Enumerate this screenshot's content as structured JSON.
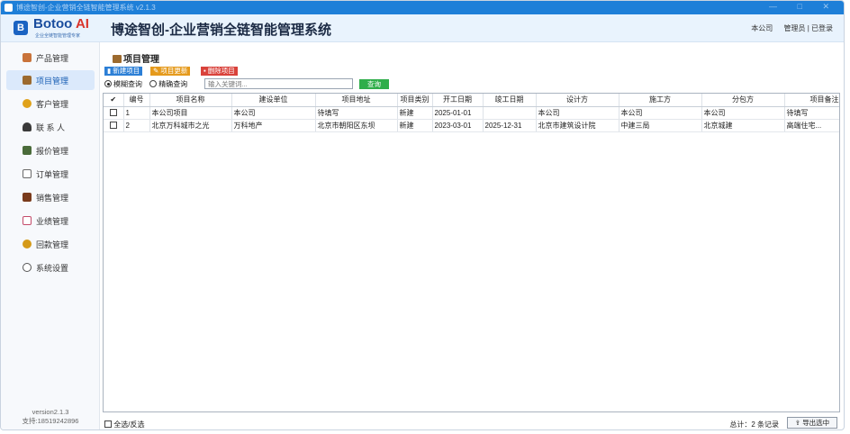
{
  "window": {
    "title": "博途智创-企业营销全链智能管理系统 v2.1.3",
    "controls": "— □ ✕"
  },
  "header": {
    "logo_letter": "B",
    "logo_text": "Botoo",
    "logo_ai": "AI",
    "logo_sub": "企业全链智能管理专家",
    "app_title": "博途智创-企业营销全链智能管理系统",
    "company": "本公司",
    "user": "管理员 | 已登录"
  },
  "sidebar": {
    "items": [
      {
        "label": "产品管理",
        "icon": "product-icon",
        "color": "#c9733a"
      },
      {
        "label": "项目管理",
        "icon": "project-icon",
        "color": "#9c6a2e"
      },
      {
        "label": "客户管理",
        "icon": "customer-icon",
        "color": "#e0a21a"
      },
      {
        "label": "联 系 人",
        "icon": "contacts-icon",
        "color": "#3a3a3a"
      },
      {
        "label": "报价管理",
        "icon": "quote-icon",
        "color": "#4a6b3a"
      },
      {
        "label": "订单管理",
        "icon": "order-icon",
        "color": "#6a6a6a"
      },
      {
        "label": "销售管理",
        "icon": "sales-icon",
        "color": "#7a3b1c"
      },
      {
        "label": "业绩管理",
        "icon": "performance-icon",
        "color": "#c44b6a"
      },
      {
        "label": "回款管理",
        "icon": "payment-icon",
        "color": "#d59a18"
      },
      {
        "label": "系统设置",
        "icon": "settings-icon",
        "color": "#555555"
      }
    ],
    "active_index": 1,
    "version": "version2.1.3",
    "support": "支持:18519242896"
  },
  "main": {
    "page_title": "项目管理",
    "toolbar": {
      "new_label": "新建项目",
      "edit_label": "项目更新",
      "delete_label": "删除项目"
    },
    "search": {
      "fuzzy_label": "模糊查询",
      "exact_label": "精确查询",
      "placeholder": "输入关键词...",
      "button_label": "查询"
    },
    "table": {
      "check_header": "✔",
      "columns": [
        "编号",
        "项目名称",
        "建设单位",
        "项目地址",
        "项目类别",
        "开工日期",
        "竣工日期",
        "设计方",
        "施工方",
        "分包方",
        "项目备注"
      ],
      "rows": [
        [
          "1",
          "本公司项目",
          "本公司",
          "待填写",
          "新建",
          "2025-01-01",
          "",
          "本公司",
          "本公司",
          "本公司",
          "待填写"
        ],
        [
          "2",
          "北京万科城市之光",
          "万科地产",
          "北京市朝阳区东坝",
          "新建",
          "2023-03-01",
          "2025-12-31",
          "北京市建筑设计院",
          "中建三局",
          "北京城建",
          "高端住宅..."
        ]
      ]
    },
    "footer": {
      "select_all_label": "全选/反选",
      "total_label": "总计：2 条记录",
      "export_label": "导出选中"
    }
  },
  "colors": {
    "titlebar": "#1e7fd8",
    "header_bg": "#e9f3fd",
    "new_btn": "#2c7fd6",
    "edit_btn": "#e59a1c",
    "delete_btn": "#d9423b",
    "search_btn": "#2fae4a"
  }
}
